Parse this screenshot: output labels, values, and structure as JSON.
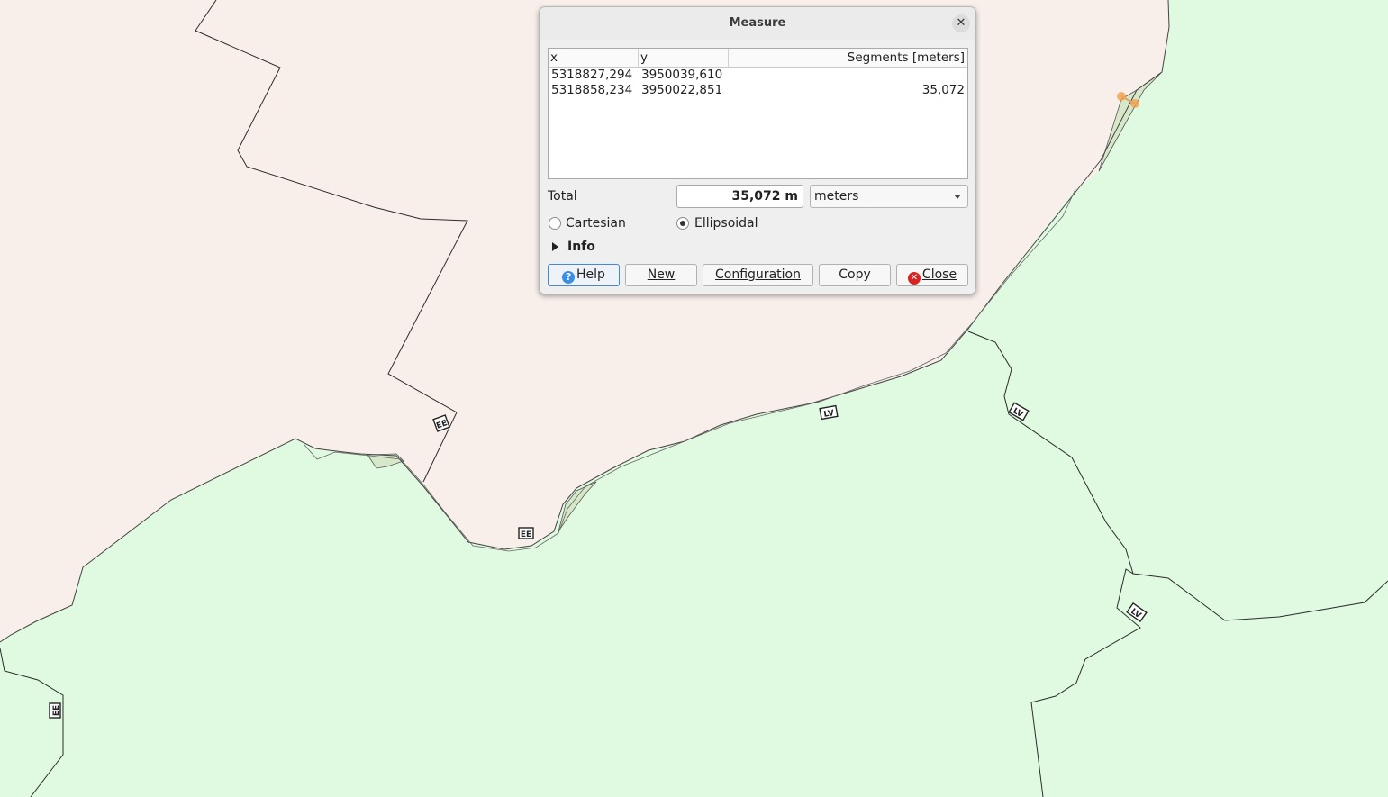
{
  "dialog": {
    "title": "Measure",
    "close_glyph": "✕",
    "table": {
      "columns": [
        "x",
        "y",
        "Segments [meters]"
      ],
      "rows": [
        {
          "x": "5318827,294",
          "y": "3950039,610",
          "segment": ""
        },
        {
          "x": "5318858,234",
          "y": "3950022,851",
          "segment": "35,072"
        }
      ]
    },
    "total_label": "Total",
    "total_value": "35,072 m",
    "unit_selected": "meters",
    "cartesian_label": "Cartesian",
    "ellipsoidal_label": "Ellipsoidal",
    "selected_mode": "Ellipsoidal",
    "info_label": "Info",
    "buttons": {
      "help": {
        "icon": "?",
        "label": "Help"
      },
      "new": {
        "label": "New"
      },
      "configuration": {
        "label": "Configuration"
      },
      "copy": {
        "label": "Copy"
      },
      "close": {
        "icon": "✕",
        "label": "Close"
      }
    }
  },
  "map": {
    "colors": {
      "land_a": "#f8efea",
      "land_b": "#e0f9e1",
      "coast_strip": "#d7e8c9",
      "border_line": "#2b2b2b",
      "measure_vertex": "#f0a050"
    },
    "road_shields": [
      "ΕΕ",
      "ΕΕ",
      "ΕΕ",
      "LV",
      "LV",
      "LV"
    ]
  }
}
